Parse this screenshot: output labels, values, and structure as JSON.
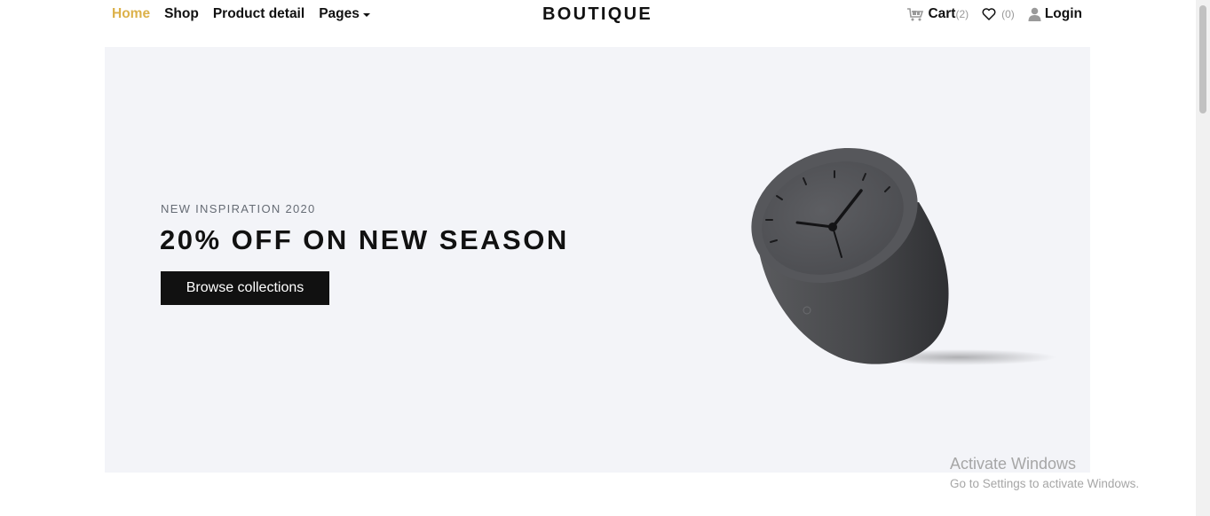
{
  "nav": {
    "left": [
      {
        "label": "Home",
        "active": true
      },
      {
        "label": "Shop"
      },
      {
        "label": "Product detail"
      },
      {
        "label": "Pages",
        "dropdown": true
      }
    ],
    "brand": "BOUTIQUE",
    "cart": {
      "label": "Cart",
      "count": "(2)",
      "icon": "cart-icon"
    },
    "wishlist": {
      "count": "(0)",
      "icon": "heart-icon"
    },
    "login": {
      "label": "Login",
      "icon": "user-icon"
    }
  },
  "hero": {
    "eyebrow": "NEW INSPIRATION 2020",
    "headline": "20% OFF ON NEW SEASON",
    "cta": "Browse collections",
    "image": "desk-clock"
  },
  "watermark": {
    "title": "Activate Windows",
    "subtitle": "Go to Settings to activate Windows."
  },
  "colors": {
    "accent": "#dcb14a",
    "hero_bg": "#f3f4f8",
    "text": "#111111",
    "button_bg": "#111111"
  }
}
